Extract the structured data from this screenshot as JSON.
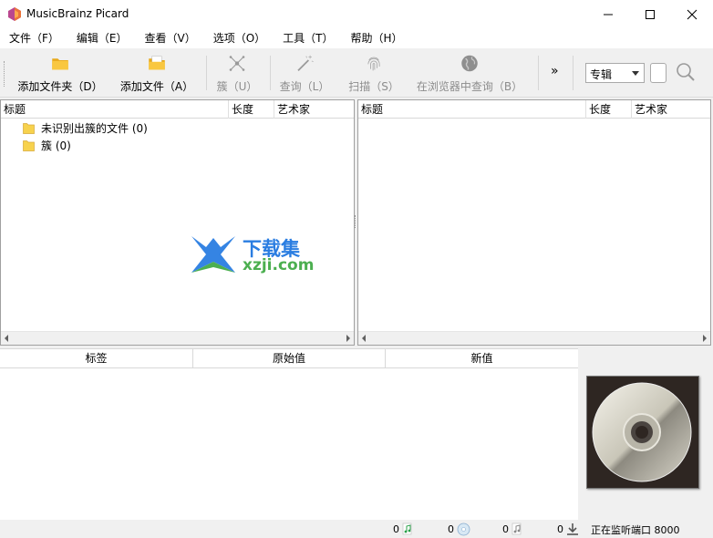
{
  "window": {
    "title": "MusicBrainz Picard",
    "controls": [
      "minimize-icon",
      "maximize-icon",
      "close-icon"
    ]
  },
  "menu": [
    {
      "label": "文件（F）"
    },
    {
      "label": "编辑（E）"
    },
    {
      "label": "查看（V）"
    },
    {
      "label": "选项（O）"
    },
    {
      "label": "工具（T）"
    },
    {
      "label": "帮助（H）"
    }
  ],
  "toolbar": {
    "add_folder": "添加文件夹（D）",
    "add_files": "添加文件（A）",
    "cluster": "簇（U）",
    "lookup": "查询（L）",
    "scan": "扫描（S）",
    "browser_lookup": "在浏览器中查询（B）",
    "more": "»",
    "search_type": "专辑"
  },
  "left_pane": {
    "columns": [
      "标题",
      "长度",
      "艺术家"
    ],
    "items": [
      {
        "label": "未识别出簇的文件 (0)"
      },
      {
        "label": "簇 (0)"
      }
    ]
  },
  "right_pane": {
    "columns": [
      "标题",
      "长度",
      "艺术家"
    ]
  },
  "metadata": {
    "columns": [
      "标签",
      "原始值",
      "新值"
    ]
  },
  "watermark": {
    "cn": "下载集",
    "url": "xzji.com"
  },
  "status": {
    "files_count": "0",
    "albums_count": "0",
    "pending_files": "0",
    "pending_requests": "0",
    "listening": "正在监听端口 8000"
  },
  "colors": {
    "folder": "#f7d24d",
    "accent": "#2a7de1",
    "watermark_green": "#4caf50"
  }
}
